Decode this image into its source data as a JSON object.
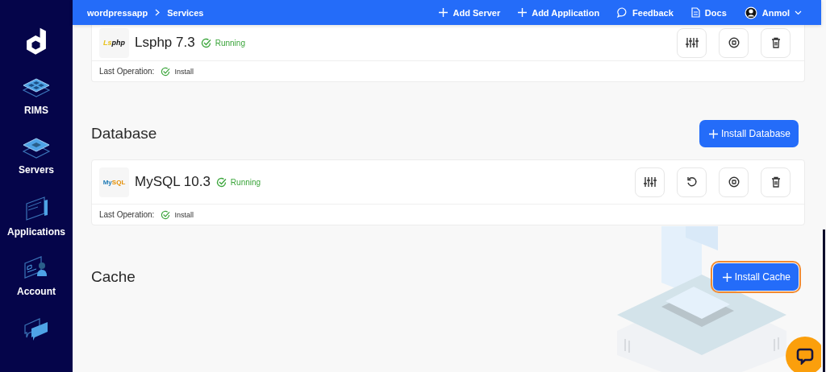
{
  "sidebar": {
    "items": [
      {
        "kind": "rims",
        "label": "RIMS"
      },
      {
        "kind": "servers",
        "label": "Servers"
      },
      {
        "kind": "applications",
        "label": "Applications"
      },
      {
        "kind": "account",
        "label": "Account"
      },
      {
        "kind": "support"
      }
    ]
  },
  "topbar": {
    "breadcrumb": [
      {
        "label": "wordpressapp"
      },
      {
        "label": "Services"
      }
    ],
    "actions": [
      {
        "kind": "add",
        "label": "Add Server"
      },
      {
        "kind": "add",
        "label": "Add Application"
      },
      {
        "kind": "feedback",
        "label": "Feedback"
      },
      {
        "kind": "docs",
        "label": "Docs"
      }
    ],
    "user": {
      "name": "Anmol"
    }
  },
  "sections": [
    {
      "services": [
        {
          "logo": {
            "kind": "lsphp",
            "text": "Lsphp"
          },
          "name": "Lsphp 7.3",
          "status": "Running",
          "last_operation_label": "Last Operation:",
          "last_operation": "Install",
          "actions": [
            {
              "kind": "settings"
            },
            {
              "kind": "stop"
            },
            {
              "kind": "delete"
            }
          ]
        }
      ]
    },
    {
      "heading": "Database",
      "button": {
        "label": "Install Database",
        "highlighted": false
      },
      "services": [
        {
          "logo": {
            "kind": "mysql",
            "text": "MySQL"
          },
          "name": "MySQL 10.3",
          "status": "Running",
          "last_operation_label": "Last Operation:",
          "last_operation": "Install",
          "actions": [
            {
              "kind": "settings"
            },
            {
              "kind": "restart"
            },
            {
              "kind": "stop"
            },
            {
              "kind": "delete"
            }
          ]
        }
      ]
    },
    {
      "heading": "Cache",
      "button": {
        "label": "Install Cache",
        "highlighted": true
      }
    }
  ]
}
